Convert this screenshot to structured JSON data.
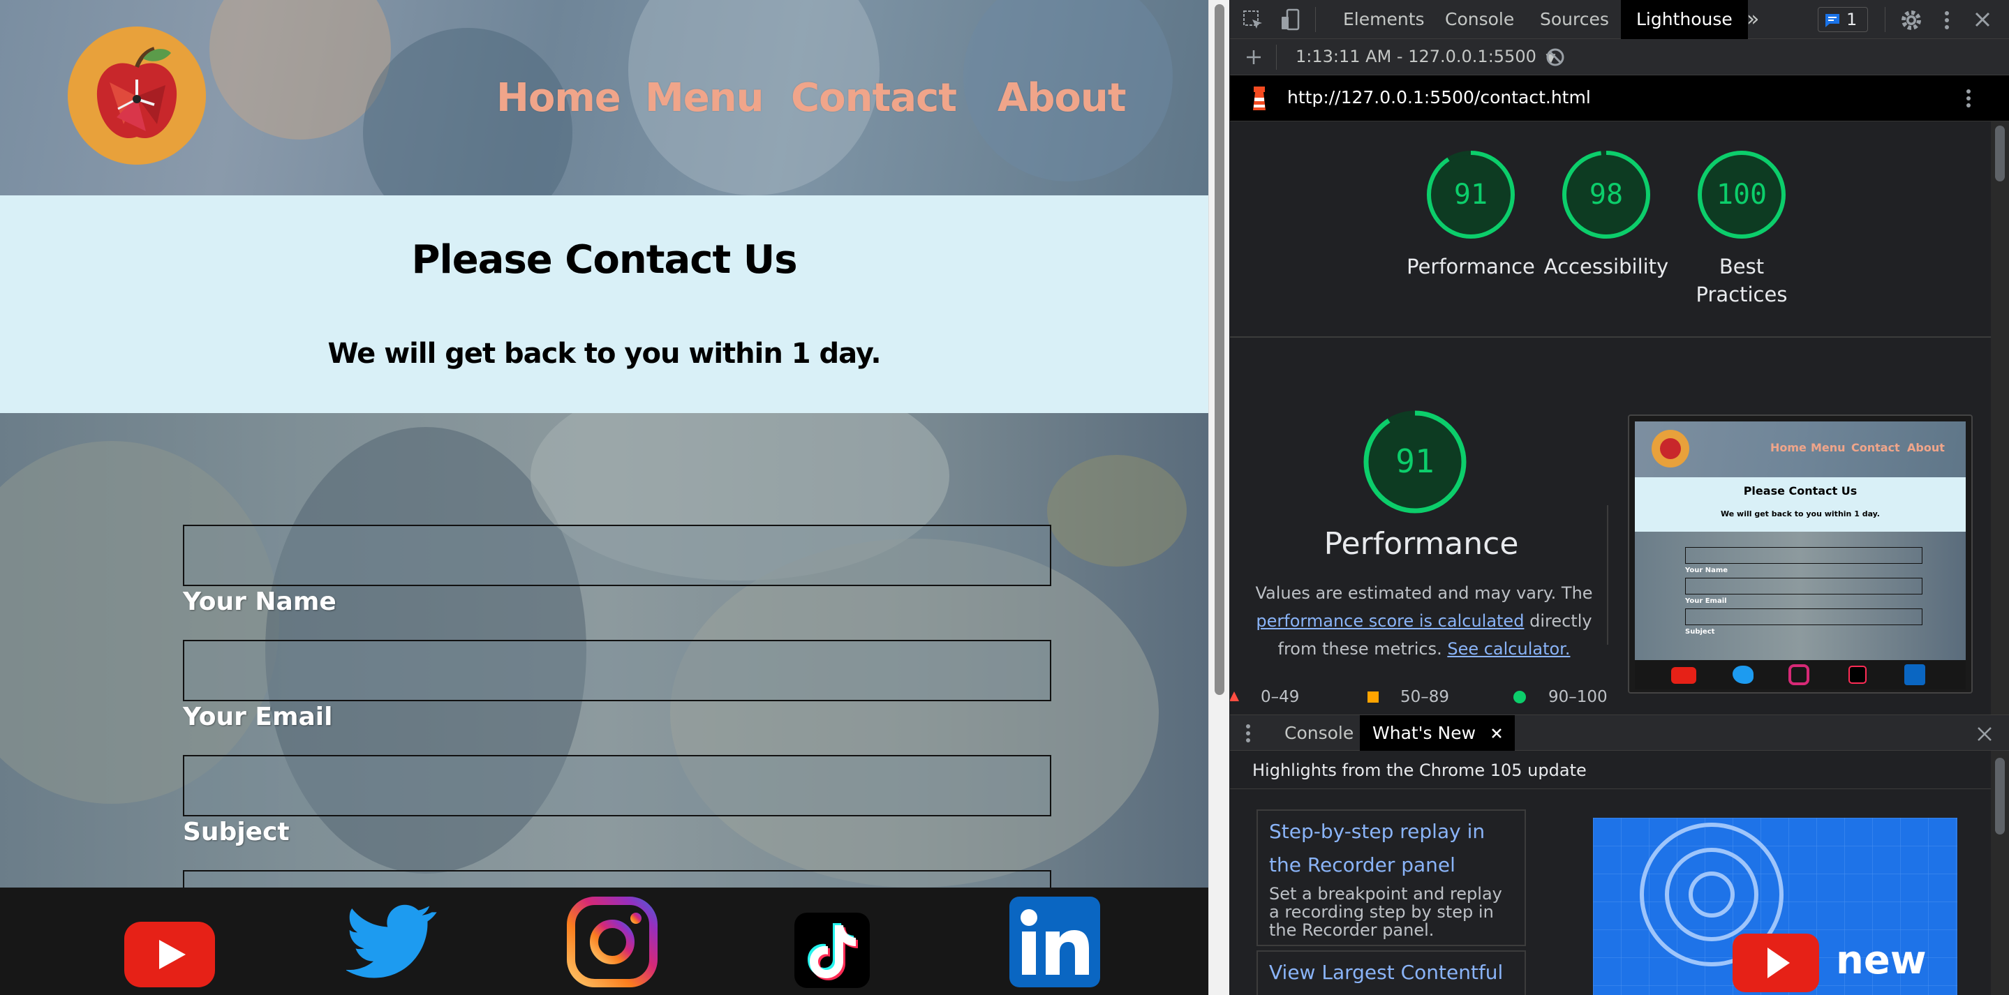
{
  "site": {
    "nav": [
      "Home",
      "Menu",
      "Contact",
      "About"
    ],
    "banner_title": "Please Contact Us",
    "banner_subtitle": "We will get back to you within 1 day.",
    "form_labels": [
      "Your Name",
      "Your Email",
      "Subject"
    ],
    "social_icons": [
      "youtube-icon",
      "twitter-icon",
      "instagram-icon",
      "tiktok-icon",
      "linkedin-icon"
    ]
  },
  "devtools": {
    "tabs": [
      "Elements",
      "Console",
      "Sources",
      "Lighthouse"
    ],
    "active_tab": "Lighthouse",
    "more_tabs": "»",
    "issues_count": "1",
    "report_selector": "1:13:11 AM - 127.0.0.1:5500",
    "url": "http://127.0.0.1:5500/contact.html",
    "scores": [
      {
        "value": "91",
        "label": "Performance"
      },
      {
        "value": "98",
        "label": "Accessibility"
      },
      {
        "value": "100",
        "label": "Best Practices"
      }
    ],
    "performance": {
      "score": "91",
      "title": "Performance",
      "desc_1": "Values are estimated and may vary. The",
      "link_1": "performance score is calculated",
      "desc_2": "directly from these metrics.",
      "link_2": "See calculator."
    },
    "legend": [
      "0–49",
      "50–89",
      "90–100"
    ],
    "preview": {
      "nav": [
        "Home",
        "Menu",
        "Contact",
        "About"
      ],
      "title": "Please Contact Us",
      "subtitle": "We will get back to you within 1 day.",
      "labels": [
        "Your Name",
        "Your Email",
        "Subject"
      ]
    },
    "drawer_tabs": [
      "Console",
      "What's New"
    ],
    "drawer_active": "What's New",
    "whats_new_header": "Highlights from the Chrome 105 update",
    "cards": [
      {
        "title": "Step-by-step replay in the Recorder panel",
        "desc": "Set a breakpoint and replay a recording step by step in the Recorder panel."
      },
      {
        "title": "View Largest Contentful",
        "desc": ""
      }
    ],
    "video_caption": "new"
  },
  "colors": {
    "nav": "#f0a58a",
    "banner": "#d9f0f7",
    "score_green": "#0cce6b",
    "score_bg": "#0d3b22",
    "link": "#8ab4f8",
    "lighthouse_tab_bg": "#000000"
  }
}
